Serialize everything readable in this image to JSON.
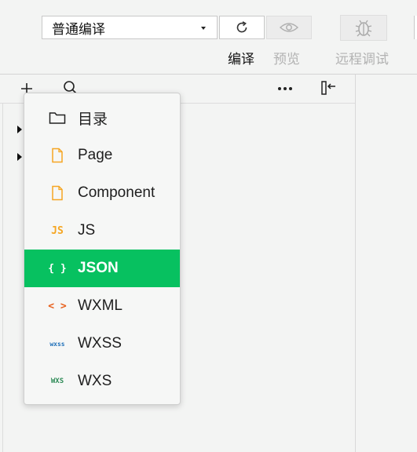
{
  "toolbar": {
    "mode_select": "普通编译",
    "compile_label": "编译",
    "preview_label": "预览",
    "remote_debug_label": "远程调试"
  },
  "explorer": {
    "header_icons": [
      "plus-icon",
      "search-icon",
      "more-icon",
      "collapse-sidebar-icon"
    ]
  },
  "new_menu": {
    "items": [
      {
        "label": "目录",
        "icon": "folder-icon"
      },
      {
        "label": "Page",
        "icon": "page-file-icon"
      },
      {
        "label": "Component",
        "icon": "component-file-icon"
      },
      {
        "label": "JS",
        "icon": "js-icon",
        "icon_text": "JS"
      },
      {
        "label": "JSON",
        "icon": "json-icon",
        "icon_text": "{ }",
        "active": true
      },
      {
        "label": "WXML",
        "icon": "wxml-icon",
        "icon_text": "< >"
      },
      {
        "label": "WXSS",
        "icon": "wxss-icon",
        "icon_text": "wxss"
      },
      {
        "label": "WXS",
        "icon": "wxs-icon",
        "icon_text": "WXS"
      }
    ]
  },
  "colors": {
    "active_item": "#07c160",
    "file_orange": "#f5a623",
    "wxml_orange": "#e8601c",
    "wxss_blue": "#1e6fb8",
    "wxs_green": "#2e8b57"
  }
}
